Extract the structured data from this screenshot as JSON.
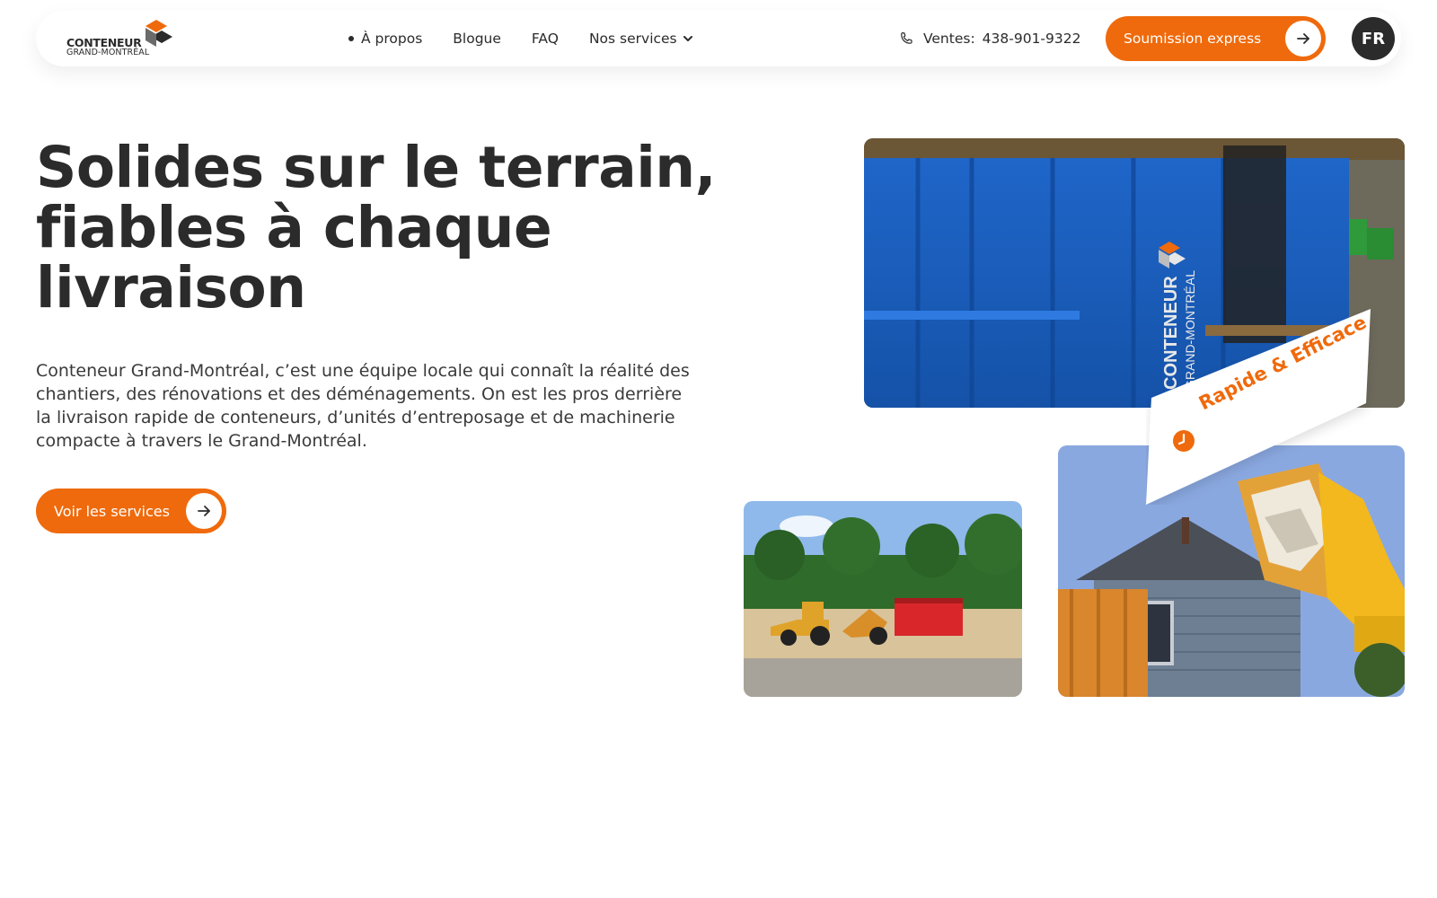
{
  "brand": {
    "name_line1": "CONTENEUR",
    "name_line2": "GRAND-MONTRÉAL",
    "accent_color": "#ef6a0c",
    "dark_color": "#2b2b2b"
  },
  "nav": {
    "items": [
      {
        "label": "À propos",
        "active": true
      },
      {
        "label": "Blogue"
      },
      {
        "label": "FAQ"
      },
      {
        "label": "Nos services",
        "has_dropdown": true
      }
    ]
  },
  "header": {
    "phone_prefix": "Ventes:",
    "phone_number": "438-901-9322",
    "quote_button": "Soumission express",
    "language": "FR"
  },
  "hero": {
    "title": "Solides sur le terrain, fiables à chaque livraison",
    "description": "Conteneur Grand-Montréal, c’est une équipe locale qui connaît la réalité des chantiers, des rénovations et des déménagements. On est les pros derrière la livraison rapide de conteneurs, d’unités d’entreposage et de machinerie compacte à travers le Grand-Montréal.",
    "cta_label": "Voir les services"
  },
  "images": {
    "dumpster_print_line1": "CONTENEUR",
    "dumpster_print_line2": "GRAND-MONTRÉAL"
  },
  "badge": {
    "label": "Rapide & Efficace",
    "icon": "clock-icon"
  }
}
